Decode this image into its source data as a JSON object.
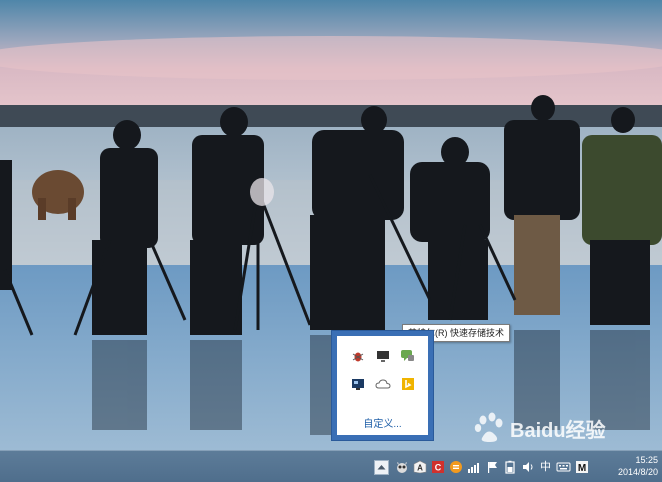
{
  "tooltip": {
    "text": "英特尔(R) 快速存储技术"
  },
  "overflow_popup": {
    "customize_label": "自定义...",
    "icons": [
      {
        "name": "bug-icon"
      },
      {
        "name": "monitor-icon"
      },
      {
        "name": "chat-bubble-icon"
      },
      {
        "name": "display-settings-icon"
      },
      {
        "name": "cloud-icon"
      },
      {
        "name": "bing-icon"
      }
    ]
  },
  "watermark": {
    "text": "Baidu经验"
  },
  "taskbar": {
    "clock": {
      "time": "15:25",
      "date": "2014/8/20"
    },
    "tray_icons": [
      "show-hidden-icons-button",
      "owl-icon",
      "a-letter-icon",
      "c-red-icon",
      "orange-circle-icon",
      "signal-bars-icon",
      "flag-icon",
      "battery-icon",
      "volume-icon",
      "ime-zhong-icon",
      "ime-keyboard-icon",
      "m-letter-icon"
    ],
    "ime_label": "中",
    "m_label": "M",
    "a_label": "A",
    "c_label": "C"
  },
  "colors": {
    "accent": "#3a6fb5",
    "link": "#1f5fa8",
    "taskbar": "#55738f"
  }
}
